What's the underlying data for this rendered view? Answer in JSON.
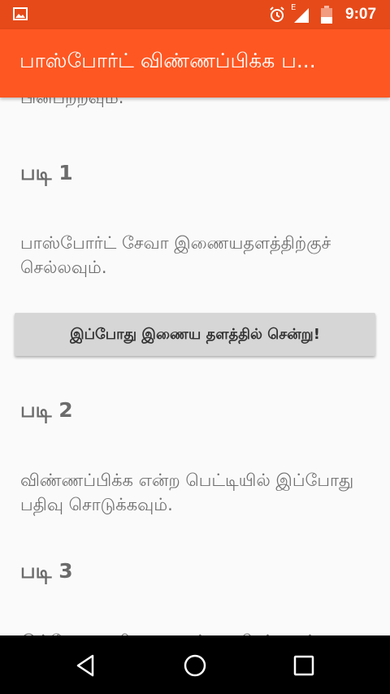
{
  "status_bar": {
    "time": "9:07",
    "signal_type": "E",
    "icons": [
      "gallery-icon",
      "alarm-icon",
      "signal-icon",
      "battery-icon"
    ]
  },
  "app_bar": {
    "title": "பாஸ்போர்ட் விண்ணப்பிக்க ப..."
  },
  "content": {
    "previous_text": "பின்பற்றவும்.",
    "steps": [
      {
        "heading": "படி 1",
        "text": "பாஸ்போர்ட் சேவா இணையதளத்திற்குச் செல்லவும்.",
        "button_label": "இப்போது இணைய தளத்தில் சென்று!"
      },
      {
        "heading": "படி 2",
        "text": "விண்ணப்பிக்க என்ற பெட்டியில் இப்போது பதிவு சொடுக்கவும்."
      },
      {
        "heading": "படி 3",
        "text": "இப்போது பதிவு படிவத்தை நிரப்பவும்."
      }
    ]
  },
  "nav_bar": {
    "buttons": [
      "back-icon",
      "home-icon",
      "recents-icon"
    ]
  },
  "colors": {
    "status_bar": "#e64a19",
    "app_bar": "#ff5722",
    "background": "#fafafa",
    "button": "#d6d6d6"
  }
}
